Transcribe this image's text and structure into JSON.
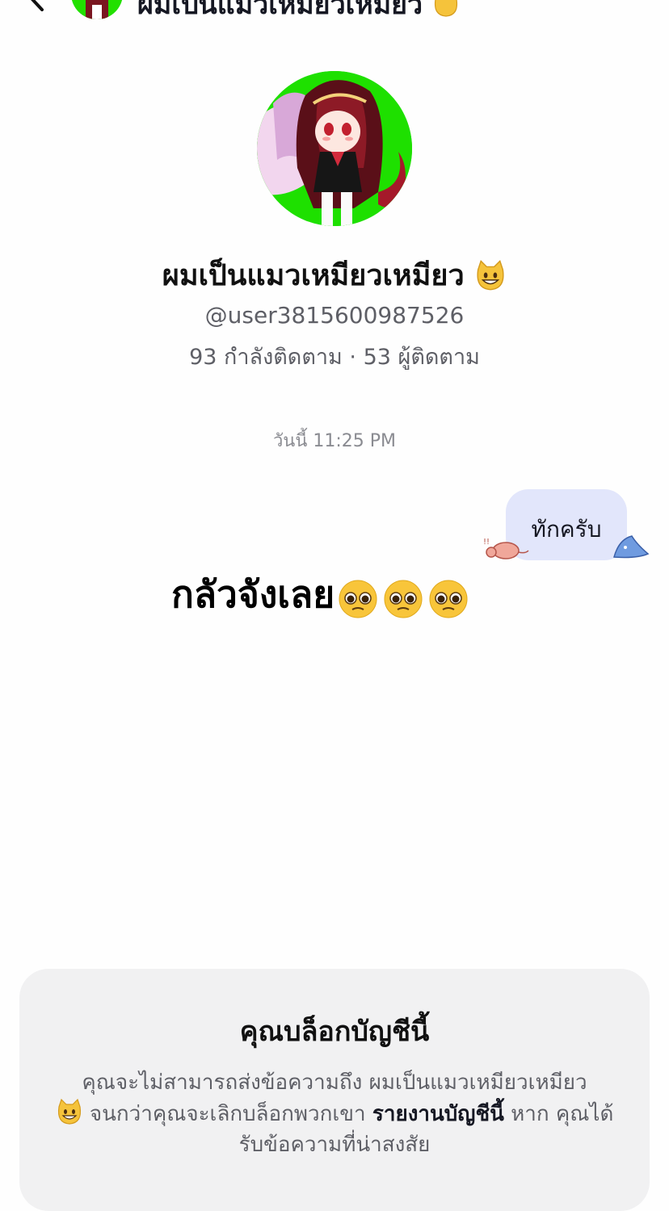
{
  "header": {
    "title": "ผมเป็นแมวเหมียวเหมียว",
    "back_icon": "chevron-left-icon",
    "avatar_icon": "anime-avatar"
  },
  "profile": {
    "display_name": "ผมเป็นแมวเหมียวเหมียว",
    "username": "@user3815600987526",
    "stats": "93 กำลังติดตาม · 53 ผู้ติดตาม",
    "avatar_bg_color": "#1ee000"
  },
  "chat": {
    "timestamp": "วันนี้ 11:25 PM",
    "messages": [
      {
        "text": "ทักครับ",
        "sender": "me"
      }
    ]
  },
  "overlay": {
    "caption": "กลัวจังเลย"
  },
  "blocked_card": {
    "title": "คุณบล็อกบัญชีนี้",
    "body_part1": "คุณจะไม่สามารถส่งข้อความถึง ผมเป็นแมวเหมียวเหมียว",
    "body_part2": " จนกว่าคุณจะเลิกบล็อกพวกเขา ",
    "report_link": "รายงานบัญชีนี้",
    "body_part3": " หาก คุณได้รับข้อความที่น่าสงสัย"
  }
}
